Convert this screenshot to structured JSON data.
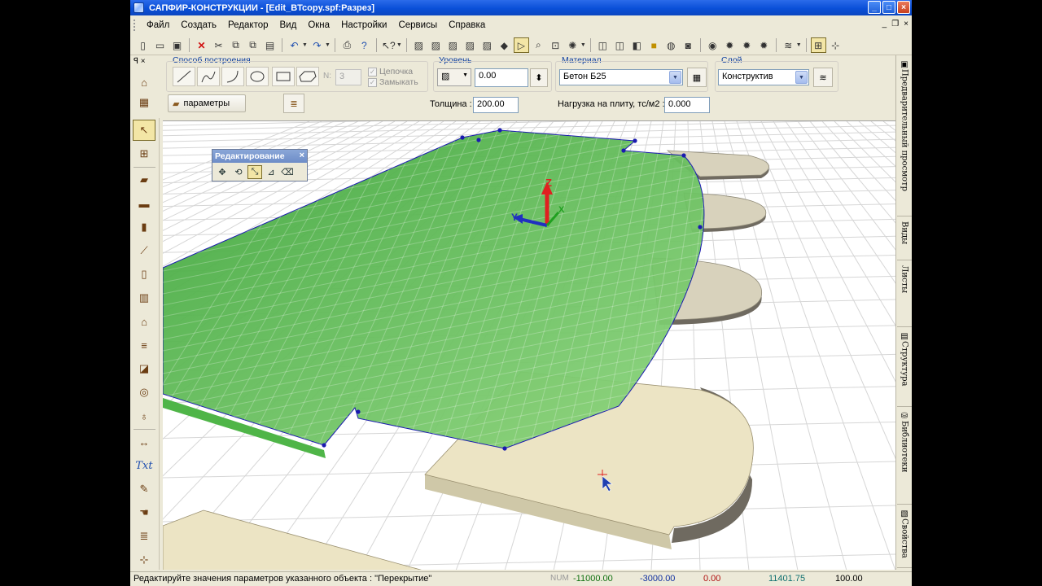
{
  "window": {
    "title": "САПФИР-КОНСТРУКЦИИ - [Edit_BTcopy.spf:Разрез]",
    "buttons": {
      "minimize": "_",
      "maximize": "□",
      "close": "×"
    }
  },
  "menu": [
    "Файл",
    "Создать",
    "Редактор",
    "Вид",
    "Окна",
    "Настройки",
    "Сервисы",
    "Справка"
  ],
  "mdi_buttons": {
    "minimize": "_",
    "restore": "❐",
    "close": "×"
  },
  "props": {
    "build_method": {
      "label": "Способ построения",
      "n_label": "N:",
      "n_value": "3",
      "chain_label": "Цепочка",
      "close_label": "Замыкать"
    },
    "level": {
      "label": "Уровень",
      "value": "0.00"
    },
    "thickness": {
      "label": "Толщина :",
      "value": "200.00"
    },
    "material": {
      "label": "Материал",
      "value": "Бетон Б25"
    },
    "load": {
      "label": "Нагрузка на плиту, тс/м2 :",
      "value": "0.000"
    },
    "layer": {
      "label": "Слой",
      "value": "Конструктив"
    },
    "params_button": "параметры"
  },
  "right_tabs": [
    "Предварительный просмотр",
    "Виды",
    "Листы",
    "Структура",
    "Библиотеки",
    "Свойства"
  ],
  "edit_palette": {
    "title": "Редактирование",
    "close": "×"
  },
  "viewport": {
    "axes": {
      "x": "X",
      "y": "Y",
      "z": "Z"
    }
  },
  "status": {
    "message": "Редактируйте значения параметров указанного объекта : \"Перекрытие\"",
    "num": "NUM",
    "x": "-11000.00",
    "y": "-3000.00",
    "z": "0.00",
    "dist": "11401.75",
    "zoom": "100.00"
  },
  "colors": {
    "titlebar": "#0a4fd8",
    "slab_green": "#62c25a",
    "slab_beige": "#ece4c4",
    "x_coord": "#107010",
    "y_coord": "#1030a0",
    "z_coord": "#b01010"
  }
}
